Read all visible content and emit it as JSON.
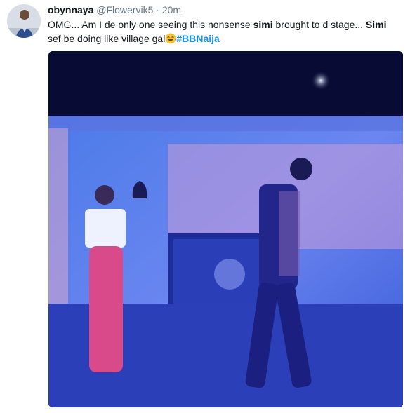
{
  "tweet": {
    "author_name": "obynnaya",
    "handle": "@Flowervik5",
    "separator": "·",
    "time": "20m",
    "text_parts": [
      "OMG... Am I de only one seeing this nonsense ",
      "simi",
      " brought to d stage... ",
      "Simi",
      " sef be doing like village gal"
    ],
    "hashtag": "#BBNaija"
  },
  "colors": {
    "link": "#1b95e0",
    "secondary_text": "#657786",
    "text": "#14171a"
  },
  "icons": {
    "emoji": "face-with-tears-of-joy-icon",
    "avatar": "user-avatar"
  }
}
